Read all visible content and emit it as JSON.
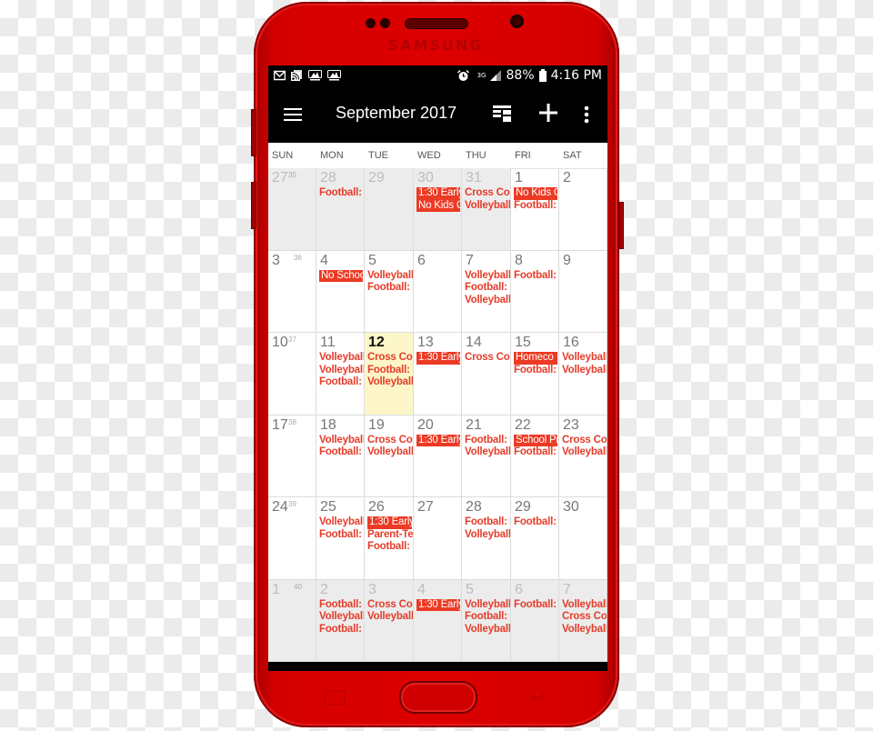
{
  "device": {
    "brand": "SAMSUNG",
    "body_color": "#d40000"
  },
  "status_bar": {
    "left_icons": [
      "gmail-icon",
      "rss-icon",
      "mlb-icon",
      "mlb-icon"
    ],
    "alarm_icon": "alarm-icon",
    "network": "3G",
    "signal_icon": "signal-icon",
    "battery": "88%",
    "battery_icon": "battery-icon",
    "time": "4:16 PM"
  },
  "toolbar": {
    "menu_icon": "hamburger-menu-icon",
    "title": "September 2017",
    "view_icon": "view-layout-icon",
    "add_icon": "add-icon",
    "more_icon": "more-vert-icon"
  },
  "calendar": {
    "days_of_week": [
      "SUN",
      "MON",
      "TUE",
      "WED",
      "THU",
      "FRI",
      "SAT"
    ],
    "accent_color": "#ec3a24",
    "today": "12",
    "weeks": [
      {
        "week_number": "35",
        "days": [
          {
            "day": "27",
            "other": true,
            "events": []
          },
          {
            "day": "28",
            "other": true,
            "events": [
              {
                "text": "Football:",
                "block": false
              }
            ]
          },
          {
            "day": "29",
            "other": true,
            "events": []
          },
          {
            "day": "30",
            "other": true,
            "events": [
              {
                "text": "1:30 Early",
                "block": true
              },
              {
                "text": "No Kids C",
                "block": true
              }
            ]
          },
          {
            "day": "31",
            "other": true,
            "events": [
              {
                "text": "Cross Co",
                "block": false
              },
              {
                "text": "Volleyball",
                "block": false
              }
            ]
          },
          {
            "day": "1",
            "other": false,
            "events": [
              {
                "text": "No Kids C",
                "block": true
              },
              {
                "text": "Football:",
                "block": false
              }
            ]
          },
          {
            "day": "2",
            "other": false,
            "events": []
          }
        ]
      },
      {
        "week_number": "36",
        "days": [
          {
            "day": "3",
            "other": false,
            "events": []
          },
          {
            "day": "4",
            "other": false,
            "events": [
              {
                "text": "No Schoo",
                "block": true
              }
            ]
          },
          {
            "day": "5",
            "other": false,
            "events": [
              {
                "text": "Volleyball",
                "block": false
              },
              {
                "text": "Football:",
                "block": false
              }
            ]
          },
          {
            "day": "6",
            "other": false,
            "events": []
          },
          {
            "day": "7",
            "other": false,
            "events": [
              {
                "text": "Volleyball",
                "block": false
              },
              {
                "text": "Football:",
                "block": false
              },
              {
                "text": "Volleyball",
                "block": false
              }
            ]
          },
          {
            "day": "8",
            "other": false,
            "events": [
              {
                "text": "Football:",
                "block": false
              }
            ]
          },
          {
            "day": "9",
            "other": false,
            "events": []
          }
        ]
      },
      {
        "week_number": "37",
        "days": [
          {
            "day": "10",
            "other": false,
            "events": []
          },
          {
            "day": "11",
            "other": false,
            "events": [
              {
                "text": "Volleyball",
                "block": false
              },
              {
                "text": "Volleyball",
                "block": false
              },
              {
                "text": "Football:",
                "block": false
              }
            ]
          },
          {
            "day": "12",
            "other": false,
            "today": true,
            "events": [
              {
                "text": "Cross Co",
                "block": false
              },
              {
                "text": "Football:",
                "block": false
              },
              {
                "text": "Volleyball",
                "block": false
              }
            ]
          },
          {
            "day": "13",
            "other": false,
            "events": [
              {
                "text": "1:30 Early",
                "block": true
              }
            ]
          },
          {
            "day": "14",
            "other": false,
            "events": [
              {
                "text": "Cross Co",
                "block": false
              }
            ]
          },
          {
            "day": "15",
            "other": false,
            "events": [
              {
                "text": "Homeco",
                "block": true
              },
              {
                "text": "Football:",
                "block": false
              }
            ]
          },
          {
            "day": "16",
            "other": false,
            "events": [
              {
                "text": "Volleyball",
                "block": false
              },
              {
                "text": "Volleyball",
                "block": false
              }
            ]
          }
        ]
      },
      {
        "week_number": "38",
        "days": [
          {
            "day": "17",
            "other": false,
            "events": []
          },
          {
            "day": "18",
            "other": false,
            "events": [
              {
                "text": "Volleyball",
                "block": false
              },
              {
                "text": "Football:",
                "block": false
              }
            ]
          },
          {
            "day": "19",
            "other": false,
            "events": [
              {
                "text": "Cross Co",
                "block": false
              },
              {
                "text": "Volleyball",
                "block": false
              }
            ]
          },
          {
            "day": "20",
            "other": false,
            "events": [
              {
                "text": "1:30 Early",
                "block": true
              }
            ]
          },
          {
            "day": "21",
            "other": false,
            "events": [
              {
                "text": "Football:",
                "block": false
              },
              {
                "text": "Volleyball",
                "block": false
              }
            ]
          },
          {
            "day": "22",
            "other": false,
            "events": [
              {
                "text": "School Pi",
                "block": true
              },
              {
                "text": "Football:",
                "block": false
              }
            ]
          },
          {
            "day": "23",
            "other": false,
            "events": [
              {
                "text": "Cross Co",
                "block": false
              },
              {
                "text": "Volleyball",
                "block": false
              }
            ]
          }
        ]
      },
      {
        "week_number": "39",
        "days": [
          {
            "day": "24",
            "other": false,
            "events": []
          },
          {
            "day": "25",
            "other": false,
            "events": [
              {
                "text": "Volleyball",
                "block": false
              },
              {
                "text": "Football:",
                "block": false
              }
            ]
          },
          {
            "day": "26",
            "other": false,
            "events": [
              {
                "text": "1:30 Early",
                "block": true
              },
              {
                "text": "Parent-Te",
                "block": false
              },
              {
                "text": "Football:",
                "block": false
              }
            ]
          },
          {
            "day": "27",
            "other": false,
            "events": []
          },
          {
            "day": "28",
            "other": false,
            "events": [
              {
                "text": "Football:",
                "block": false
              },
              {
                "text": "Volleyball",
                "block": false
              }
            ]
          },
          {
            "day": "29",
            "other": false,
            "events": [
              {
                "text": "Football:",
                "block": false
              }
            ]
          },
          {
            "day": "30",
            "other": false,
            "events": []
          }
        ]
      },
      {
        "week_number": "40",
        "days": [
          {
            "day": "1",
            "other": true,
            "events": []
          },
          {
            "day": "2",
            "other": true,
            "events": [
              {
                "text": "Football:",
                "block": false
              },
              {
                "text": "Volleyball",
                "block": false
              },
              {
                "text": "Football:",
                "block": false
              }
            ]
          },
          {
            "day": "3",
            "other": true,
            "events": [
              {
                "text": "Cross Co",
                "block": false
              },
              {
                "text": "Volleyball",
                "block": false
              }
            ]
          },
          {
            "day": "4",
            "other": true,
            "events": [
              {
                "text": "1:30 Early",
                "block": true
              }
            ]
          },
          {
            "day": "5",
            "other": true,
            "events": [
              {
                "text": "Volleyball",
                "block": false
              },
              {
                "text": "Football:",
                "block": false
              },
              {
                "text": "Volleyball",
                "block": false
              }
            ]
          },
          {
            "day": "6",
            "other": true,
            "events": [
              {
                "text": "Football:",
                "block": false
              }
            ]
          },
          {
            "day": "7",
            "other": true,
            "events": [
              {
                "text": "Volleyball",
                "block": false
              },
              {
                "text": "Cross Co",
                "block": false
              },
              {
                "text": "Volleyball",
                "block": false
              }
            ]
          }
        ]
      }
    ]
  },
  "hardware_keys": {
    "recents_icon": "recents-icon",
    "home_button": "home-button",
    "back_icon": "back-icon"
  }
}
